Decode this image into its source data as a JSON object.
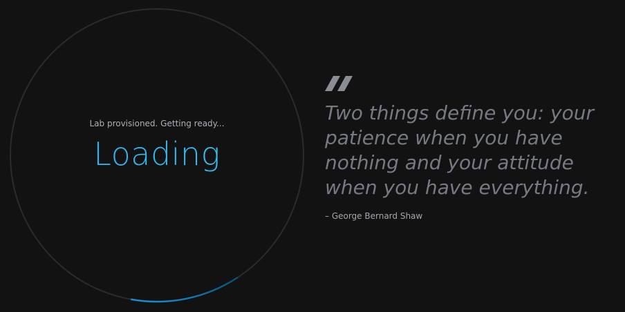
{
  "loader": {
    "status": "Lab provisioned. Getting ready...",
    "label": "Loading",
    "progress": 0.12,
    "colors": {
      "track": "#2a2b2e",
      "arc_start": "#0b5f8f",
      "arc_end": "#1d86c4",
      "text": "#2fb4ee"
    }
  },
  "quote": {
    "mark_icon": "quote-icon",
    "text": "Two things define you: your patience when you have nothing and your attitude when you have everything.",
    "author": "– George Bernard Shaw"
  },
  "background": "#121213"
}
